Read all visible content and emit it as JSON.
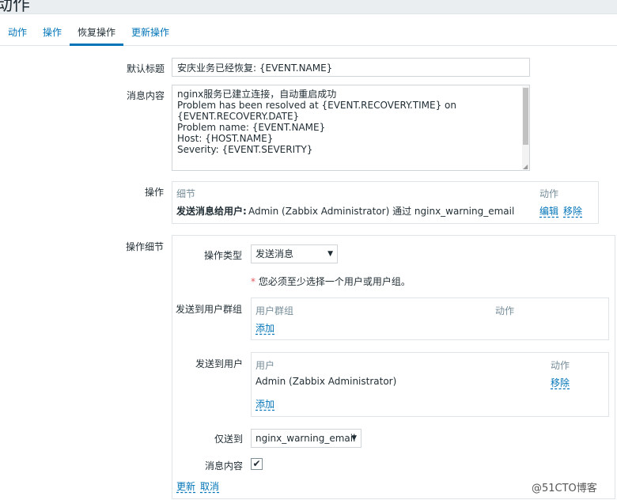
{
  "header": {
    "title": "动作"
  },
  "tabs": [
    {
      "label": "动作",
      "active": false
    },
    {
      "label": "操作",
      "active": false
    },
    {
      "label": "恢复操作",
      "active": true
    },
    {
      "label": "更新操作",
      "active": false
    }
  ],
  "form": {
    "default_subject_label": "默认标题",
    "default_subject_value": "安庆业务已经恢复: {EVENT.NAME}",
    "message_label": "消息内容",
    "message_lines": [
      "nginx服务已建立连接，自动重启成功",
      "Problem has been resolved at {EVENT.RECOVERY.TIME} on",
      "{EVENT.RECOVERY.DATE}",
      "Problem name: {EVENT.NAME}",
      "Host: {HOST.NAME}",
      "Severity: {EVENT.SEVERITY}"
    ],
    "operations_label": "操作",
    "operations_table": {
      "col_details": "细节",
      "col_action": "动作",
      "rows": [
        {
          "detail_prefix": "发送消息给用户:",
          "detail_rest": "Admin (Zabbix Administrator) 通过 nginx_warning_email",
          "edit": "编辑",
          "remove": "移除"
        }
      ]
    },
    "operation_details_label": "操作细节",
    "operation_type_label": "操作类型",
    "operation_type_value": "发送消息",
    "required_note_star": "*",
    "required_note": "您必须至少选择一个用户或用户组。",
    "send_to_groups_label": "发送到用户群组",
    "groups_table": {
      "col_group": "用户群组",
      "col_action": "动作",
      "add": "添加"
    },
    "send_to_users_label": "发送到用户",
    "users_table": {
      "col_user": "用户",
      "col_action": "动作",
      "rows": [
        {
          "user": "Admin (Zabbix Administrator)",
          "remove": "移除"
        }
      ],
      "add": "添加"
    },
    "send_only_to_label": "仅送到",
    "send_only_to_value": "nginx_warning_email",
    "message_content_label": "消息内容",
    "message_content_checked": true,
    "update_link": "更新",
    "cancel_link": "取消"
  },
  "watermark": "@51CTO博客"
}
